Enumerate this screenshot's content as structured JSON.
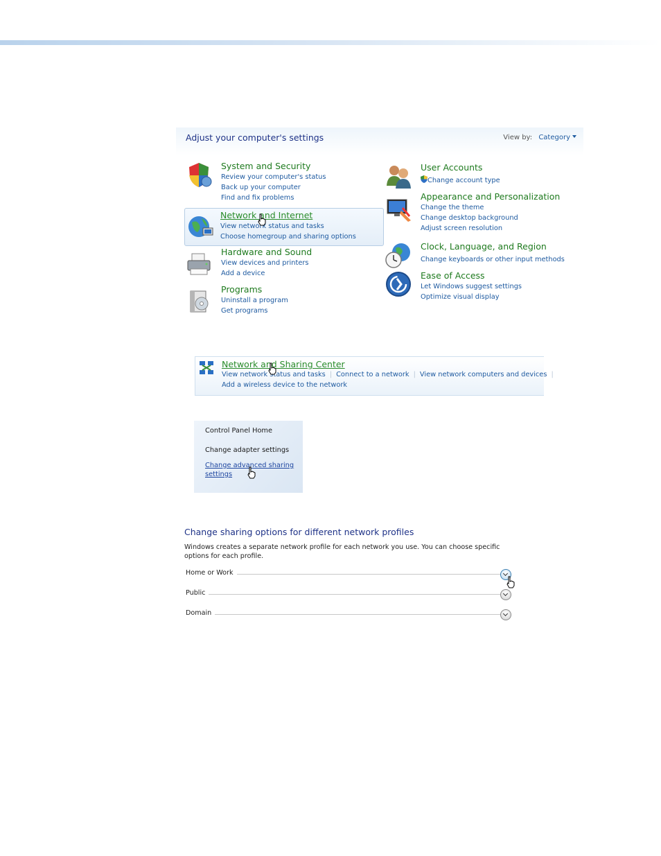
{
  "control_panel": {
    "title": "Adjust your computer's settings",
    "view_by_label": "View by:",
    "view_by_value": "Category",
    "categories_left": [
      {
        "icon": "shield-icon",
        "title": "System and Security",
        "links": [
          "Review your computer's status",
          "Back up your computer",
          "Find and fix problems"
        ]
      },
      {
        "icon": "network-globe-icon",
        "title": "Network and Internet",
        "links": [
          "View network status and tasks",
          "Choose homegroup and sharing options"
        ]
      },
      {
        "icon": "printer-icon",
        "title": "Hardware and Sound",
        "links": [
          "View devices and printers",
          "Add a device"
        ]
      },
      {
        "icon": "programs-icon",
        "title": "Programs",
        "links": [
          "Uninstall a program",
          "Get programs"
        ]
      }
    ],
    "categories_right": [
      {
        "icon": "users-icon",
        "title": "User Accounts",
        "links": [
          "Change account type"
        ]
      },
      {
        "icon": "appearance-icon",
        "title": "Appearance and Personalization",
        "links": [
          "Change the theme",
          "Change desktop background",
          "Adjust screen resolution"
        ]
      },
      {
        "icon": "clock-globe-icon",
        "title": "Clock, Language, and Region",
        "links": [
          "Change keyboards or other input methods"
        ]
      },
      {
        "icon": "ease-of-access-icon",
        "title": "Ease of Access",
        "links": [
          "Let Windows suggest settings",
          "Optimize visual display"
        ]
      }
    ]
  },
  "network_center": {
    "title": "Network and Sharing Center",
    "links": [
      "View network status and tasks",
      "Connect to a network",
      "View network computers and devices"
    ],
    "line2": "Add a wireless device to the network"
  },
  "sidebar": {
    "home": "Control Panel Home",
    "adapter": "Change adapter settings",
    "advanced_line1": "Change advanced sharing",
    "advanced_line2": "settings"
  },
  "advanced_sharing": {
    "title": "Change sharing options for different network profiles",
    "description": "Windows creates a separate network profile for each network you use. You can choose specific options for each profile.",
    "profiles": [
      "Home or Work",
      "Public",
      "Domain"
    ]
  },
  "colors": {
    "link_blue": "#1e5aa0",
    "category_green": "#1e7a1e",
    "heading_navy": "#1e3287"
  }
}
